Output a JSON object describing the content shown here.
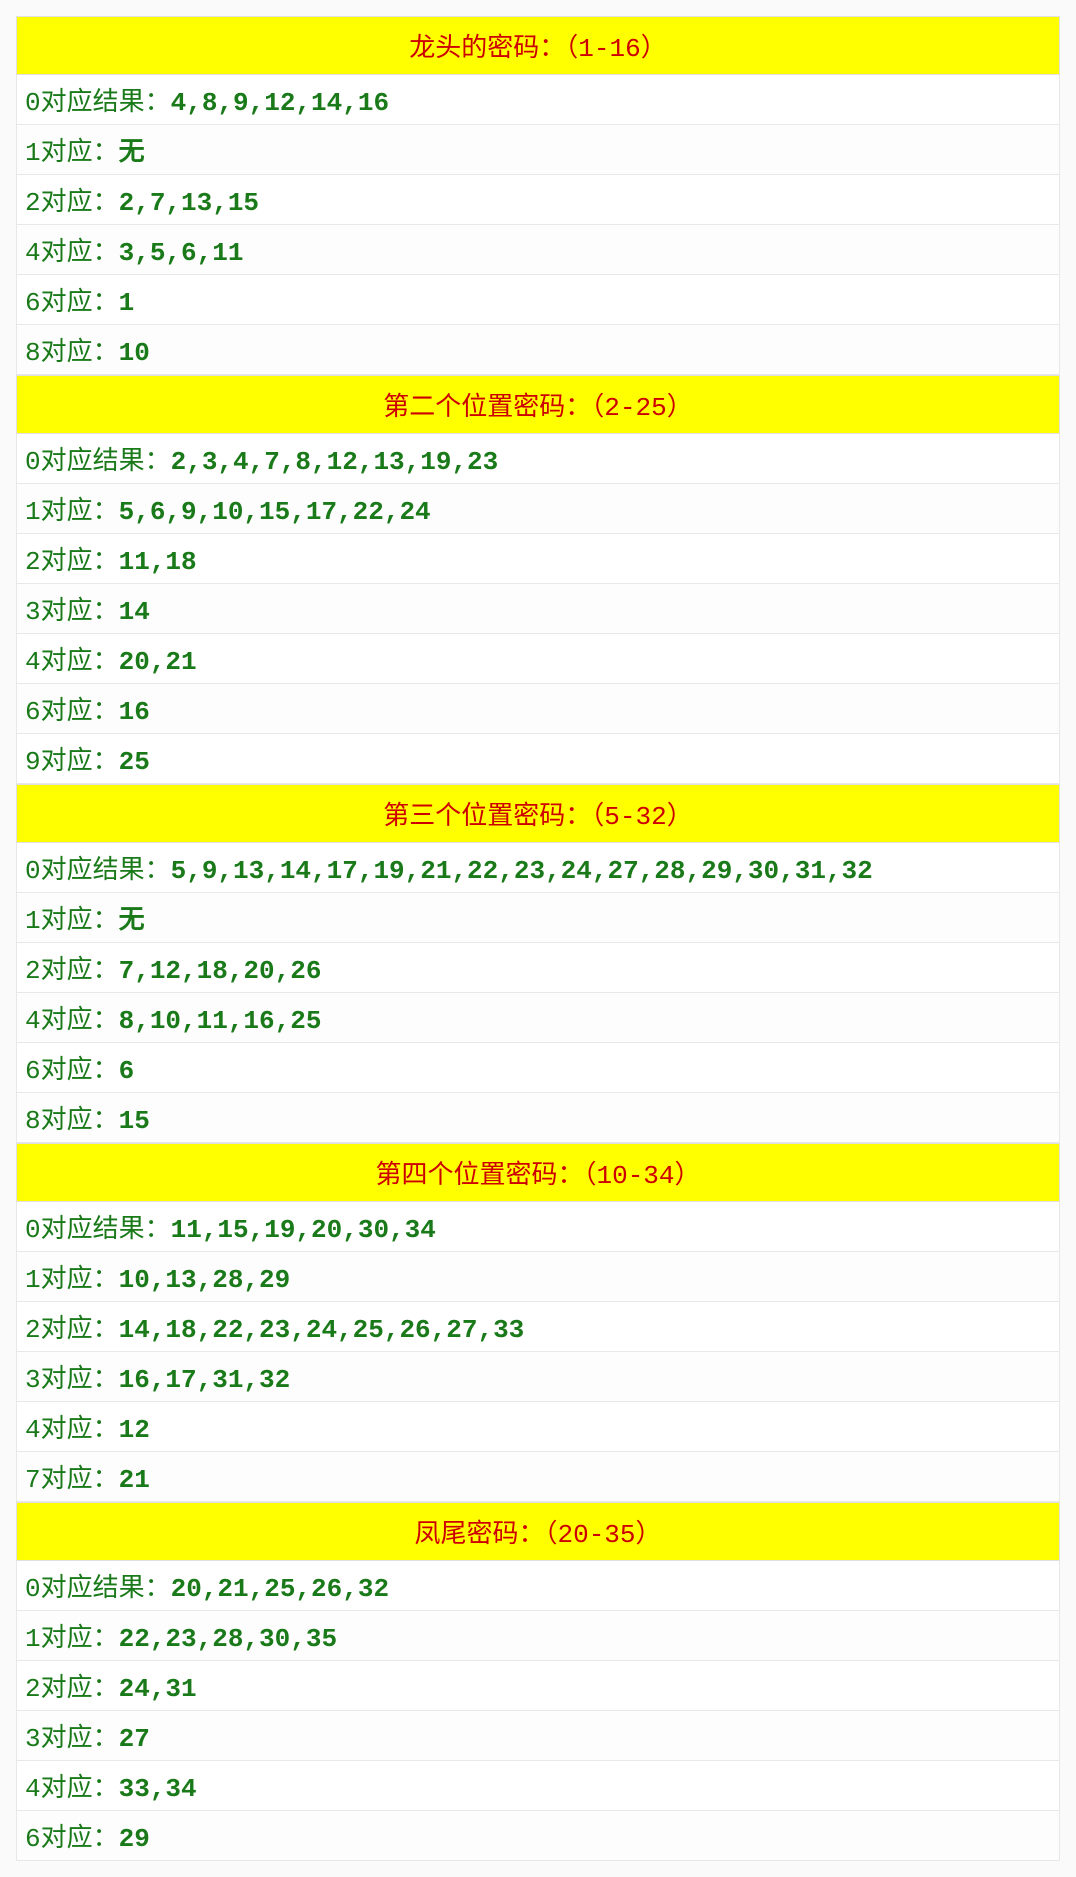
{
  "sections": [
    {
      "title": "龙头的密码：（1-16）",
      "rows": [
        {
          "label": "0对应结果：",
          "value": "4,8,9,12,14,16"
        },
        {
          "label": "1对应：",
          "value": "无"
        },
        {
          "label": "2对应：",
          "value": "2,7,13,15"
        },
        {
          "label": "4对应：",
          "value": "3,5,6,11"
        },
        {
          "label": "6对应：",
          "value": "1"
        },
        {
          "label": "8对应：",
          "value": "10"
        }
      ]
    },
    {
      "title": "第二个位置密码：（2-25）",
      "rows": [
        {
          "label": "0对应结果：",
          "value": "2,3,4,7,8,12,13,19,23"
        },
        {
          "label": "1对应：",
          "value": "5,6,9,10,15,17,22,24"
        },
        {
          "label": "2对应：",
          "value": "11,18"
        },
        {
          "label": "3对应：",
          "value": "14"
        },
        {
          "label": "4对应：",
          "value": "20,21"
        },
        {
          "label": "6对应：",
          "value": "16"
        },
        {
          "label": "9对应：",
          "value": "25"
        }
      ]
    },
    {
      "title": "第三个位置密码：（5-32）",
      "rows": [
        {
          "label": "0对应结果：",
          "value": "5,9,13,14,17,19,21,22,23,24,27,28,29,30,31,32"
        },
        {
          "label": "1对应：",
          "value": "无"
        },
        {
          "label": "2对应：",
          "value": "7,12,18,20,26"
        },
        {
          "label": "4对应：",
          "value": "8,10,11,16,25"
        },
        {
          "label": "6对应：",
          "value": "6"
        },
        {
          "label": "8对应：",
          "value": "15"
        }
      ]
    },
    {
      "title": "第四个位置密码：（10-34）",
      "rows": [
        {
          "label": "0对应结果：",
          "value": "11,15,19,20,30,34"
        },
        {
          "label": "1对应：",
          "value": "10,13,28,29"
        },
        {
          "label": "2对应：",
          "value": "14,18,22,23,24,25,26,27,33"
        },
        {
          "label": "3对应：",
          "value": "16,17,31,32"
        },
        {
          "label": "4对应：",
          "value": "12"
        },
        {
          "label": "7对应：",
          "value": "21"
        }
      ]
    },
    {
      "title": "凤尾密码：（20-35）",
      "rows": [
        {
          "label": "0对应结果：",
          "value": "20,21,25,26,32"
        },
        {
          "label": "1对应：",
          "value": "22,23,28,30,35"
        },
        {
          "label": "2对应：",
          "value": "24,31"
        },
        {
          "label": "3对应：",
          "value": "27"
        },
        {
          "label": "4对应：",
          "value": "33,34"
        },
        {
          "label": "6对应：",
          "value": "29"
        }
      ]
    }
  ]
}
